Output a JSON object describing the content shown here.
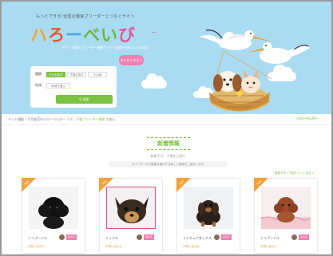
{
  "hero": {
    "tagline": "もっとできる!全国の優良ブリーダーとつなぐサイト",
    "logo_parts": [
      "ハ",
      "ろ",
      "ー",
      "べい",
      "び"
    ],
    "logo_ruby": "ー",
    "subline": "子犬・子猫のブリーダー直販サイト 全国から安心してお迎え",
    "about_badge": "はじめての方へ",
    "search": {
      "row1_label": "種類",
      "row1_options": [
        "子犬を探す",
        "子猫を探す",
        "その他"
      ],
      "row2_label": "地域",
      "row2_value": "地域を選ぶ",
      "button_label": "Q 検索"
    }
  },
  "infobar": {
    "text_pre": "ペット通販・子犬販売のハローべいびー",
    "text_green": "子犬・子猫ブリーダー直販",
    "text_post": "で安心",
    "brand": "ハローべいびー"
  },
  "news": {
    "title": "新着情報",
    "subtitle": "新着子犬・子猫をご紹介",
    "description": "ブリーダーから直接お届けする新しい家族をご紹介します",
    "more": "新着子犬・子猫をもっと見る >"
  },
  "cards": [
    {
      "ribbon": "NEW",
      "name": "トイプードル",
      "tag": "女の子",
      "price": "お問い合わせ"
    },
    {
      "ribbon": "NEW",
      "name": "ミックス",
      "tag": "男の子",
      "price": "お問い合わせ"
    },
    {
      "ribbon": "NEW",
      "name": "ミニチュアダックス",
      "tag": "女の子",
      "price": "お問い合わせ"
    },
    {
      "ribbon": "NEW",
      "name": "トイプードル",
      "tag": "女の子",
      "price": "お問い合わせ"
    }
  ],
  "colors": {
    "sky": "#a9dcf3",
    "green": "#7bc142",
    "pink": "#ef7fb0",
    "orange": "#f4a137"
  }
}
